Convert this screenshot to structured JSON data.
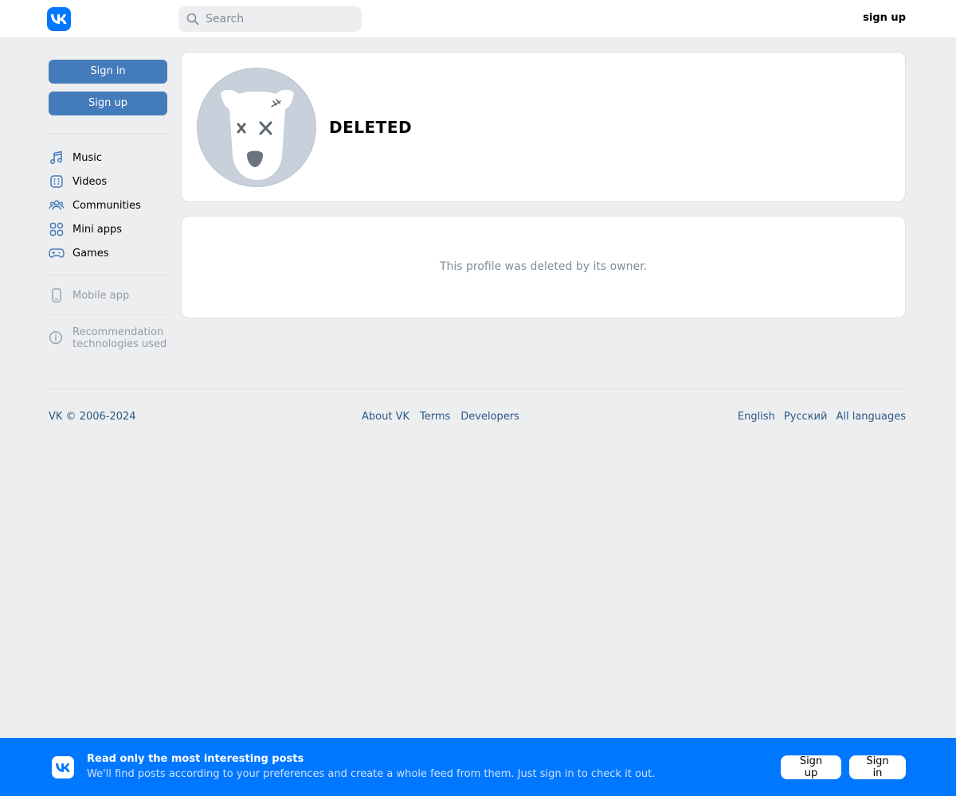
{
  "header": {
    "search_placeholder": "Search",
    "signup_label": "sign up"
  },
  "sidebar": {
    "signin_label": "Sign in",
    "signup_label": "Sign up",
    "nav": [
      {
        "label": "Music",
        "icon": "music-icon"
      },
      {
        "label": "Videos",
        "icon": "video-icon"
      },
      {
        "label": "Communities",
        "icon": "communities-icon"
      },
      {
        "label": "Mini apps",
        "icon": "mini-apps-icon"
      },
      {
        "label": "Games",
        "icon": "gamepad-icon"
      }
    ],
    "mobile_app_label": "Mobile app",
    "recommendation_label_1": "Recommendation",
    "recommendation_label_2": "technologies used"
  },
  "profile": {
    "name": "DELETED",
    "deleted_message": "This profile was deleted by its owner."
  },
  "footer": {
    "copyright": "VK © 2006-2024",
    "links": [
      "About VK",
      "Terms",
      "Developers"
    ],
    "languages": [
      "English",
      "Русский",
      "All languages"
    ]
  },
  "promo": {
    "title": "Read only the most interesting posts",
    "subtitle": "We'll find posts according to your preferences and create a whole feed from them. Just sign in to check it out.",
    "signup_label": "Sign up",
    "signin_label": "Sign in"
  },
  "colors": {
    "brand": "#0077ff",
    "button": "#447bba",
    "link": "#2a5885",
    "background": "#edeef0"
  }
}
